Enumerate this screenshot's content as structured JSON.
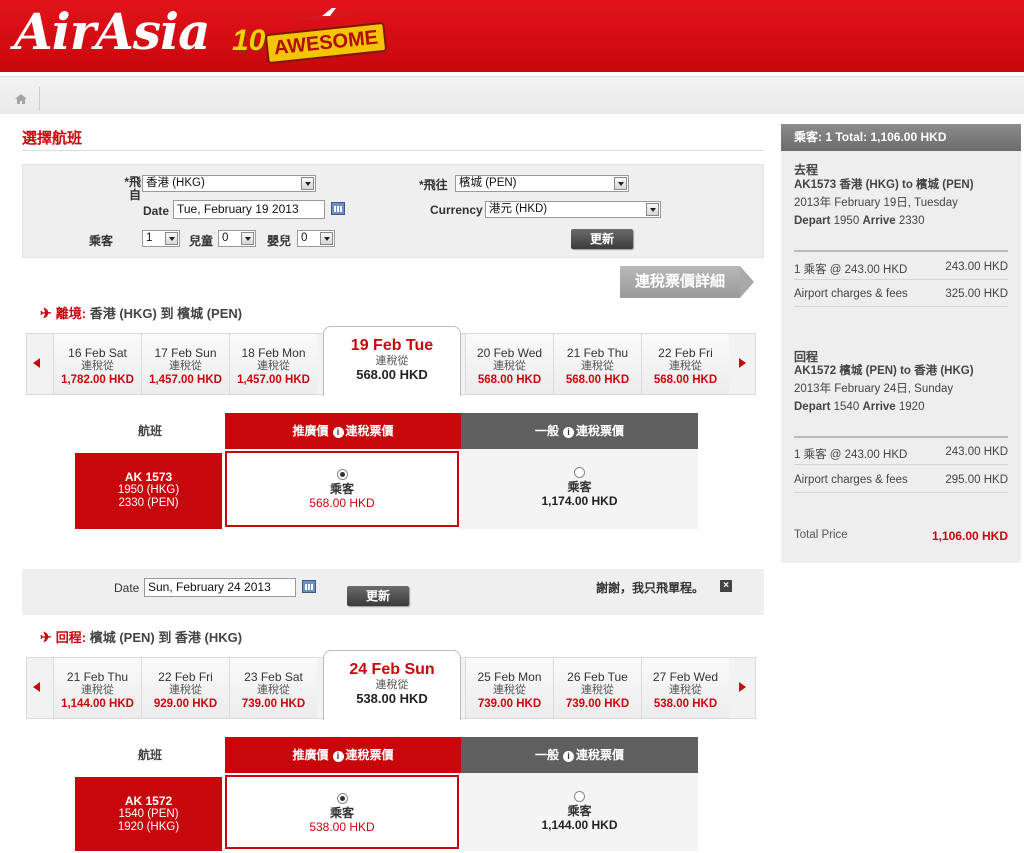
{
  "header": {
    "logo": "AirAsia",
    "promo_number": "10",
    "promo_word": "AWESOME"
  },
  "page_title": "選擇航班",
  "search": {
    "from_label": "*飛自",
    "from_value": "香港 (HKG)",
    "to_label": "*飛往",
    "to_value": "檳城 (PEN)",
    "date_label": "Date",
    "date_value": "Tue, February 19 2013",
    "currency_label": "Currency",
    "currency_value": "港元 (HKD)",
    "adult_label": "乘客",
    "adult_value": "1",
    "child_label": "兒童",
    "child_value": "0",
    "infant_label": "嬰兒",
    "infant_value": "0",
    "update_label": "更新"
  },
  "detail_button": "連稅票價詳細",
  "depart": {
    "heading_type": "離境:",
    "heading_route": "香港 (HKG) 到 檳城 (PEN)",
    "days": [
      {
        "date": "16 Feb Sat",
        "sub": "連稅從",
        "price": "1,782.00 HKD"
      },
      {
        "date": "17 Feb Sun",
        "sub": "連稅從",
        "price": "1,457.00 HKD"
      },
      {
        "date": "18 Feb Mon",
        "sub": "連稅從",
        "price": "1,457.00 HKD"
      },
      {
        "date": "19 Feb Tue",
        "sub": "連稅從",
        "price": "568.00 HKD"
      },
      {
        "date": "20 Feb Wed",
        "sub": "連稅從",
        "price": "568.00 HKD"
      },
      {
        "date": "21 Feb Thu",
        "sub": "連稅從",
        "price": "568.00 HKD"
      },
      {
        "date": "22 Feb Fri",
        "sub": "連稅從",
        "price": "568.00 HKD"
      }
    ],
    "col_flight": "航班",
    "col_promo": "推廣價",
    "col_promo_note": "連稅票價",
    "col_regular": "一般",
    "col_regular_note": "連稅票價",
    "flight_no": "AK 1573",
    "dep_time": "1950 (HKG)",
    "arr_time": "2330 (PEN)",
    "promo_pax": "乘客",
    "promo_price": "568.00 HKD",
    "regular_pax": "乘客",
    "regular_price": "1,174.00 HKD"
  },
  "return_bar": {
    "date_label": "Date",
    "date_value": "Sun, February 24 2013",
    "update_label": "更新",
    "oneway_text": "謝謝，我只飛單程。"
  },
  "return": {
    "heading_type": "回程:",
    "heading_route": "檳城 (PEN) 到 香港 (HKG)",
    "days": [
      {
        "date": "21 Feb Thu",
        "sub": "連稅從",
        "price": "1,144.00 HKD"
      },
      {
        "date": "22 Feb Fri",
        "sub": "連稅從",
        "price": "929.00 HKD"
      },
      {
        "date": "23 Feb Sat",
        "sub": "連稅從",
        "price": "739.00 HKD"
      },
      {
        "date": "24 Feb Sun",
        "sub": "連稅從",
        "price": "538.00 HKD"
      },
      {
        "date": "25 Feb Mon",
        "sub": "連稅從",
        "price": "739.00 HKD"
      },
      {
        "date": "26 Feb Tue",
        "sub": "連稅從",
        "price": "739.00 HKD"
      },
      {
        "date": "27 Feb Wed",
        "sub": "連稅從",
        "price": "538.00 HKD"
      }
    ],
    "col_flight": "航班",
    "col_promo": "推廣價",
    "col_promo_note": "連稅票價",
    "col_regular": "一般",
    "col_regular_note": "連稅票價",
    "flight_no": "AK 1572",
    "dep_time": "1540 (PEN)",
    "arr_time": "1920 (HKG)",
    "promo_pax": "乘客",
    "promo_price": "538.00 HKD",
    "regular_pax": "乘客",
    "regular_price": "1,144.00 HKD"
  },
  "sidebar": {
    "header": "乘客: 1  Total: 1,106.00 HKD",
    "out_title": "去程",
    "out_flight": "AK1573 香港 (HKG) to 檳城 (PEN)",
    "out_date": "2013年 February 19日, Tuesday",
    "out_depart_label": "Depart",
    "out_depart": "1950",
    "out_arrive_label": "Arrive",
    "out_arrive": "2330",
    "out_pax_line": "1 乘客 @ 243.00 HKD",
    "out_pax_amount": "243.00 HKD",
    "out_fee_label": "Airport charges & fees",
    "out_fee_amount": "325.00 HKD",
    "ret_title": "回程",
    "ret_flight": "AK1572 檳城 (PEN) to 香港 (HKG)",
    "ret_date": "2013年 February 24日, Sunday",
    "ret_depart_label": "Depart",
    "ret_depart": "1540",
    "ret_arrive_label": "Arrive",
    "ret_arrive": "1920",
    "ret_pax_line": "1 乘客 @ 243.00 HKD",
    "ret_pax_amount": "243.00 HKD",
    "ret_fee_label": "Airport charges & fees",
    "ret_fee_amount": "295.00 HKD",
    "total_label": "Total Price",
    "total_value": "1,106.00 HKD"
  },
  "colors": {
    "brand_red": "#c8070d",
    "dark_gray": "#5f5f5f"
  }
}
